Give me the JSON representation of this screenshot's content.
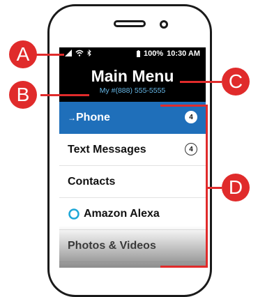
{
  "status_bar": {
    "battery": "100%",
    "time": "10:30 AM"
  },
  "header": {
    "title": "Main Menu",
    "subtitle": "My #(888) 555-5555"
  },
  "menu": [
    {
      "label": "Phone",
      "badge": "4",
      "selected": true,
      "prefix": "→ "
    },
    {
      "label": "Text Messages",
      "badge": "4",
      "selected": false
    },
    {
      "label": "Contacts"
    },
    {
      "label": "Amazon Alexa",
      "icon": "alexa-ring-icon"
    },
    {
      "label": "Photos & Videos"
    }
  ],
  "callouts": {
    "a": "A",
    "b": "B",
    "c": "C",
    "d": "D"
  },
  "colors": {
    "accent": "#1f6fba",
    "callout": "#e02b2b",
    "subtitle": "#67b8e8",
    "alexa": "#1ea7d7"
  }
}
